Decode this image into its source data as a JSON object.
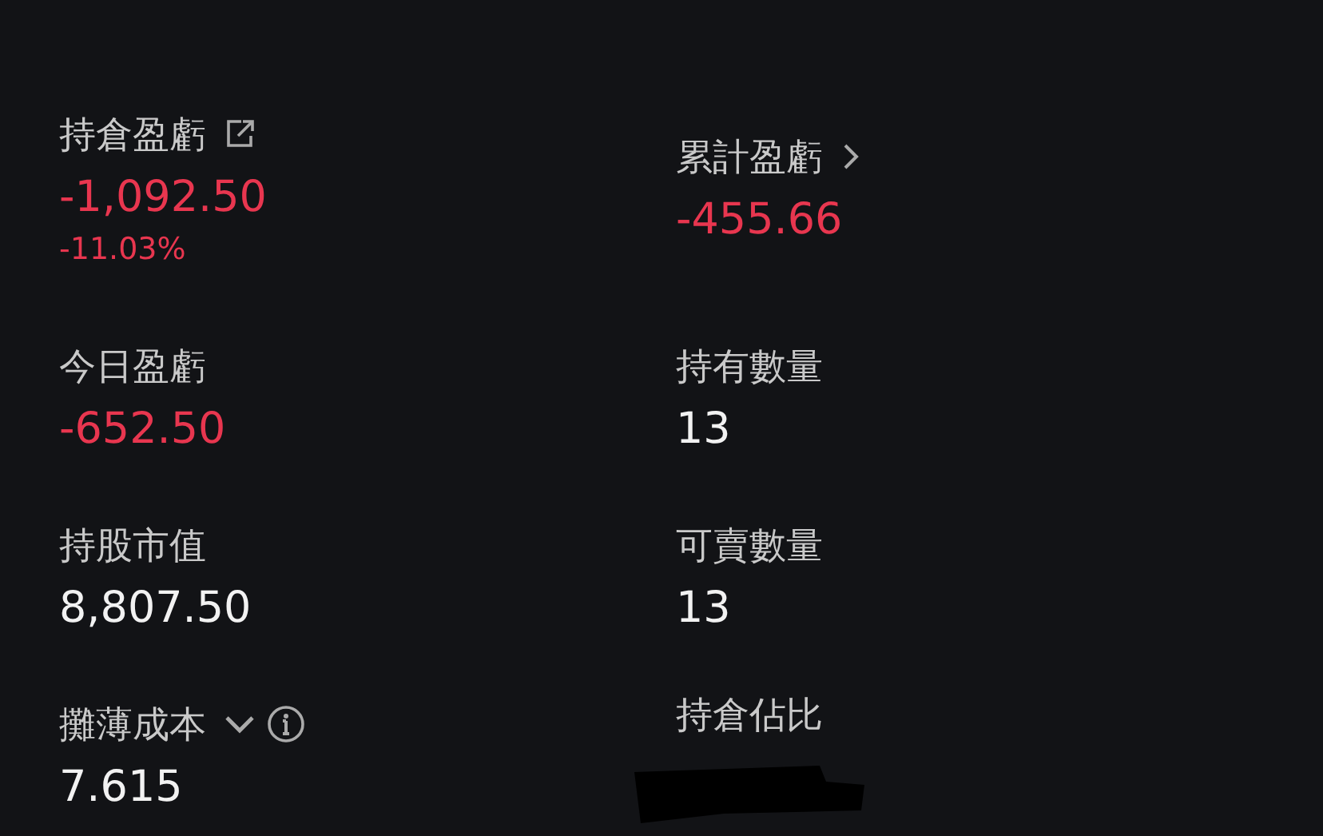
{
  "metrics": [
    {
      "kind": "shareable",
      "label": "持倉盈虧",
      "value": "-1,092.50",
      "color": "#e8364f",
      "sub": "-11.03%"
    },
    {
      "kind": "linked",
      "label": "累計盈虧",
      "value": "-455.66",
      "color": "#e8364f"
    },
    {
      "kind": "plain",
      "label": "今日盈虧",
      "value": "-652.50",
      "color": "#e8364f"
    },
    {
      "kind": "plain",
      "label": "持有數量",
      "value": "13",
      "color": "#f2f2f2"
    },
    {
      "kind": "plain",
      "label": "持股市值",
      "value": "8,807.50",
      "color": "#f2f2f2"
    },
    {
      "kind": "plain",
      "label": "可賣數量",
      "value": "13",
      "color": "#f2f2f2"
    },
    {
      "kind": "explained",
      "label": "攤薄成本",
      "value": "7.615",
      "color": "#f2f2f2"
    },
    {
      "kind": "masked",
      "label": "持倉佔比"
    }
  ]
}
